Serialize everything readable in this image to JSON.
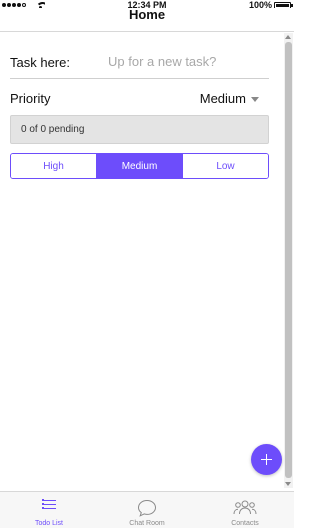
{
  "status_bar": {
    "time": "12:34 PM",
    "battery": "100%"
  },
  "header": {
    "title": "Home"
  },
  "form": {
    "task_label": "Task here:",
    "task_placeholder": "Up for a new task?",
    "task_value": "",
    "priority_label": "Priority",
    "priority_value": "Medium"
  },
  "pending": {
    "text": "0 of 0 pending"
  },
  "filter": {
    "options": [
      "High",
      "Medium",
      "Low"
    ],
    "selected": "Medium"
  },
  "tabs": [
    {
      "label": "Todo List",
      "icon": "list-icon",
      "active": true
    },
    {
      "label": "Chat Room",
      "icon": "chat-bubble-icon",
      "active": false
    },
    {
      "label": "Contacts",
      "icon": "people-icon",
      "active": false
    }
  ],
  "colors": {
    "accent": "#6d4dfb",
    "inactive_tab": "#8a8a8a",
    "pending_bg": "#e4e4e4"
  }
}
